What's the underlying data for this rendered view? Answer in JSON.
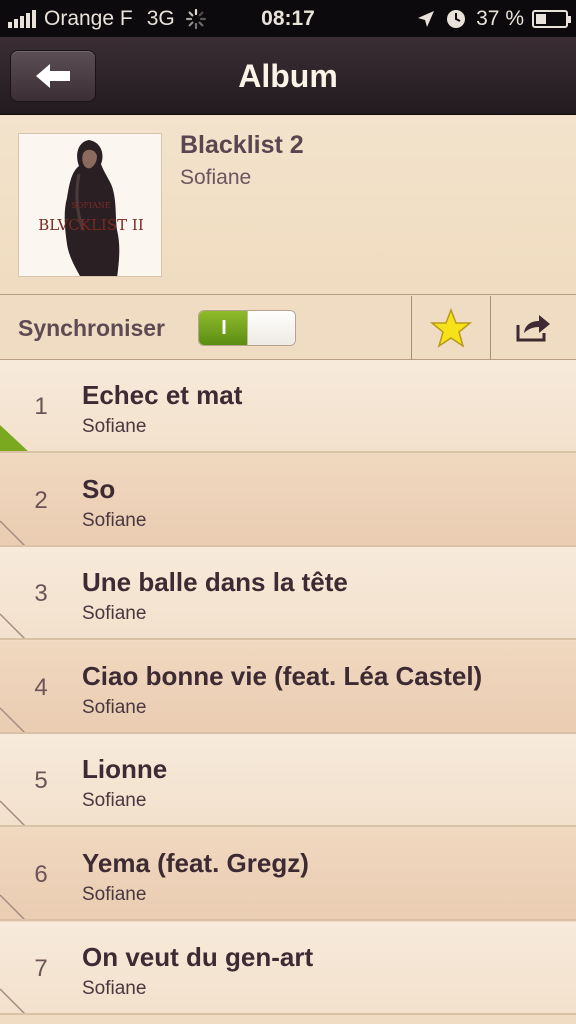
{
  "status_bar": {
    "carrier": "Orange F",
    "network": "3G",
    "time": "08:17",
    "battery_percent": "37 %",
    "battery_level": 0.37
  },
  "nav": {
    "title": "Album",
    "back_icon": "arrow-left-icon"
  },
  "album": {
    "title": "Blacklist 2",
    "artist": "Sofiane",
    "cover_text": "BLVCKLIST II",
    "cover_small_text": "SOFIANE"
  },
  "toolbar": {
    "sync_label": "Synchroniser",
    "toggle_on_text": "I",
    "toggle_state": true,
    "favorite_icon": "star-icon",
    "share_icon": "share-icon"
  },
  "colors": {
    "accent_green": "#7aa81f",
    "star": "#f7e21a"
  },
  "tracks": [
    {
      "number": "1",
      "title": "Echec et mat",
      "artist": "Sofiane",
      "playing": true
    },
    {
      "number": "2",
      "title": "So",
      "artist": "Sofiane",
      "playing": false
    },
    {
      "number": "3",
      "title": "Une balle dans la tête",
      "artist": "Sofiane",
      "playing": false
    },
    {
      "number": "4",
      "title": "Ciao bonne vie (feat. Léa Castel)",
      "artist": "Sofiane",
      "playing": false
    },
    {
      "number": "5",
      "title": "Lionne",
      "artist": "Sofiane",
      "playing": false
    },
    {
      "number": "6",
      "title": "Yema (feat. Gregz)",
      "artist": "Sofiane",
      "playing": false
    },
    {
      "number": "7",
      "title": "On veut du gen-art",
      "artist": "Sofiane",
      "playing": false
    }
  ]
}
